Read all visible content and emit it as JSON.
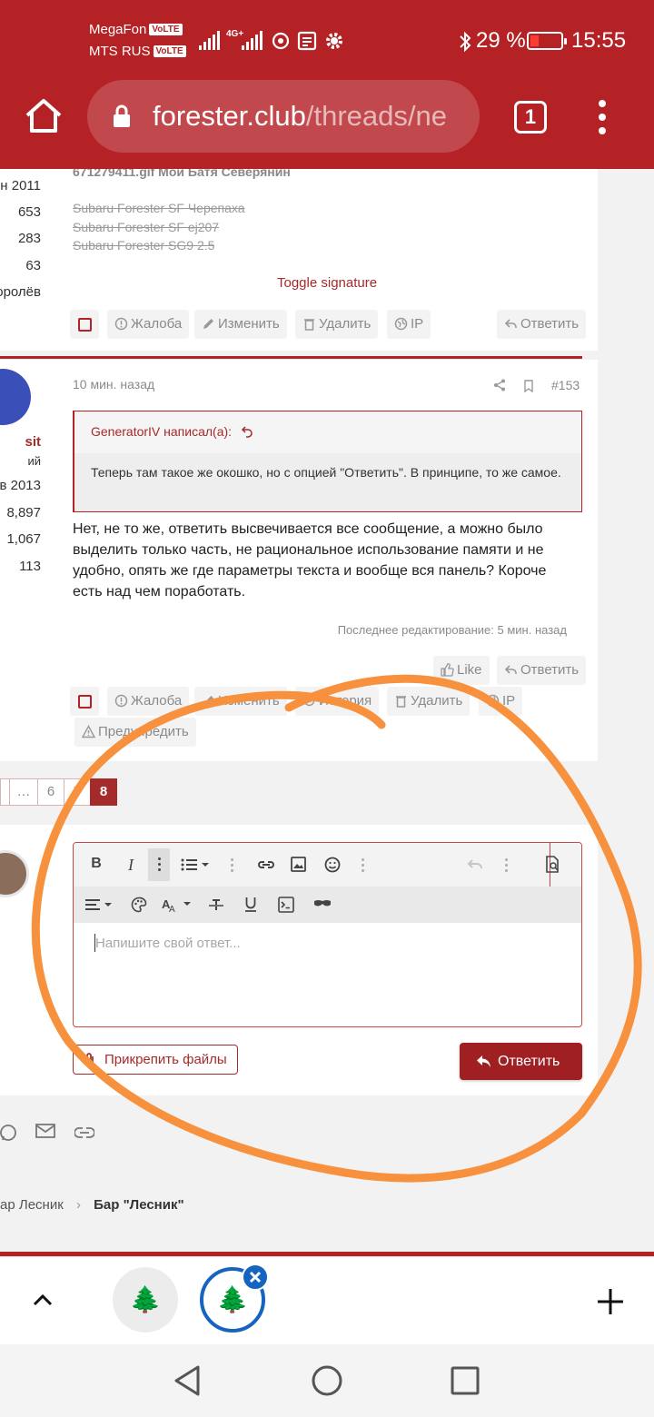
{
  "status_bar": {
    "carrier_1": "MegaFon",
    "carrier_2": "MTS RUS",
    "volte": "VoLTE",
    "network": "4G+",
    "battery_percent": "29 %",
    "time": "15:55"
  },
  "browser": {
    "url_host": "forester.club",
    "url_path": "/threads/ne",
    "tab_count": "1"
  },
  "post_prev": {
    "user_stats": [
      "н 2011",
      "653",
      "283",
      "63",
      "оролёв"
    ],
    "signature_image_alt": "671279411.gif Мой Батя Северянин",
    "signature_lines": [
      "Subaru Forester SF Черепаха",
      "Subaru Forester SF ej207",
      "Subaru Forester SG9 2.5"
    ],
    "toggle_signature": "Toggle signature",
    "actions": {
      "report": "Жалоба",
      "edit": "Изменить",
      "delete": "Удалить",
      "ip": "IP",
      "reply": "Ответить"
    }
  },
  "post_current": {
    "user_name_partial": "sit",
    "user_title_partial": "ий",
    "user_stats": [
      "в 2013",
      "8,897",
      "1,067",
      "113"
    ],
    "time_ago": "10 мин. назад",
    "post_number": "#153",
    "quote_author": "GeneratorIV написал(а):",
    "quote_text": "Теперь там такое же окошко, но с опцией \"Ответить\". В принципе, то же самое.",
    "message": "Нет, не то же, ответить высвечивается все сообщение, а можно было выделить только часть, не рациональное использование памяти и не удобно, опять же где параметры текста и вообще вся панель? Короче есть над чем поработать.",
    "last_edited": "Последнее редактирование: 5 мин. назад",
    "like": "Like",
    "reply": "Ответить",
    "actions": {
      "report": "Жалоба",
      "edit": "Изменить",
      "history": "История",
      "delete": "Удалить",
      "ip": "IP",
      "warn": "Предупредить"
    }
  },
  "pagination": {
    "pages": [
      "…",
      "6",
      "7",
      "8"
    ],
    "current": "8"
  },
  "editor": {
    "placeholder": "Напишите свой ответ...",
    "attach_label": "Прикрепить файлы",
    "submit_label": "Ответить"
  },
  "breadcrumb": {
    "item_1": "ар Лесник",
    "item_2": "Бар \"Лесник\""
  },
  "tab_switcher": {
    "tab_1_icon": "🌲",
    "tab_2_icon": "🌲"
  },
  "colors": {
    "brand": "#b42226",
    "annotation": "#f7913d"
  }
}
